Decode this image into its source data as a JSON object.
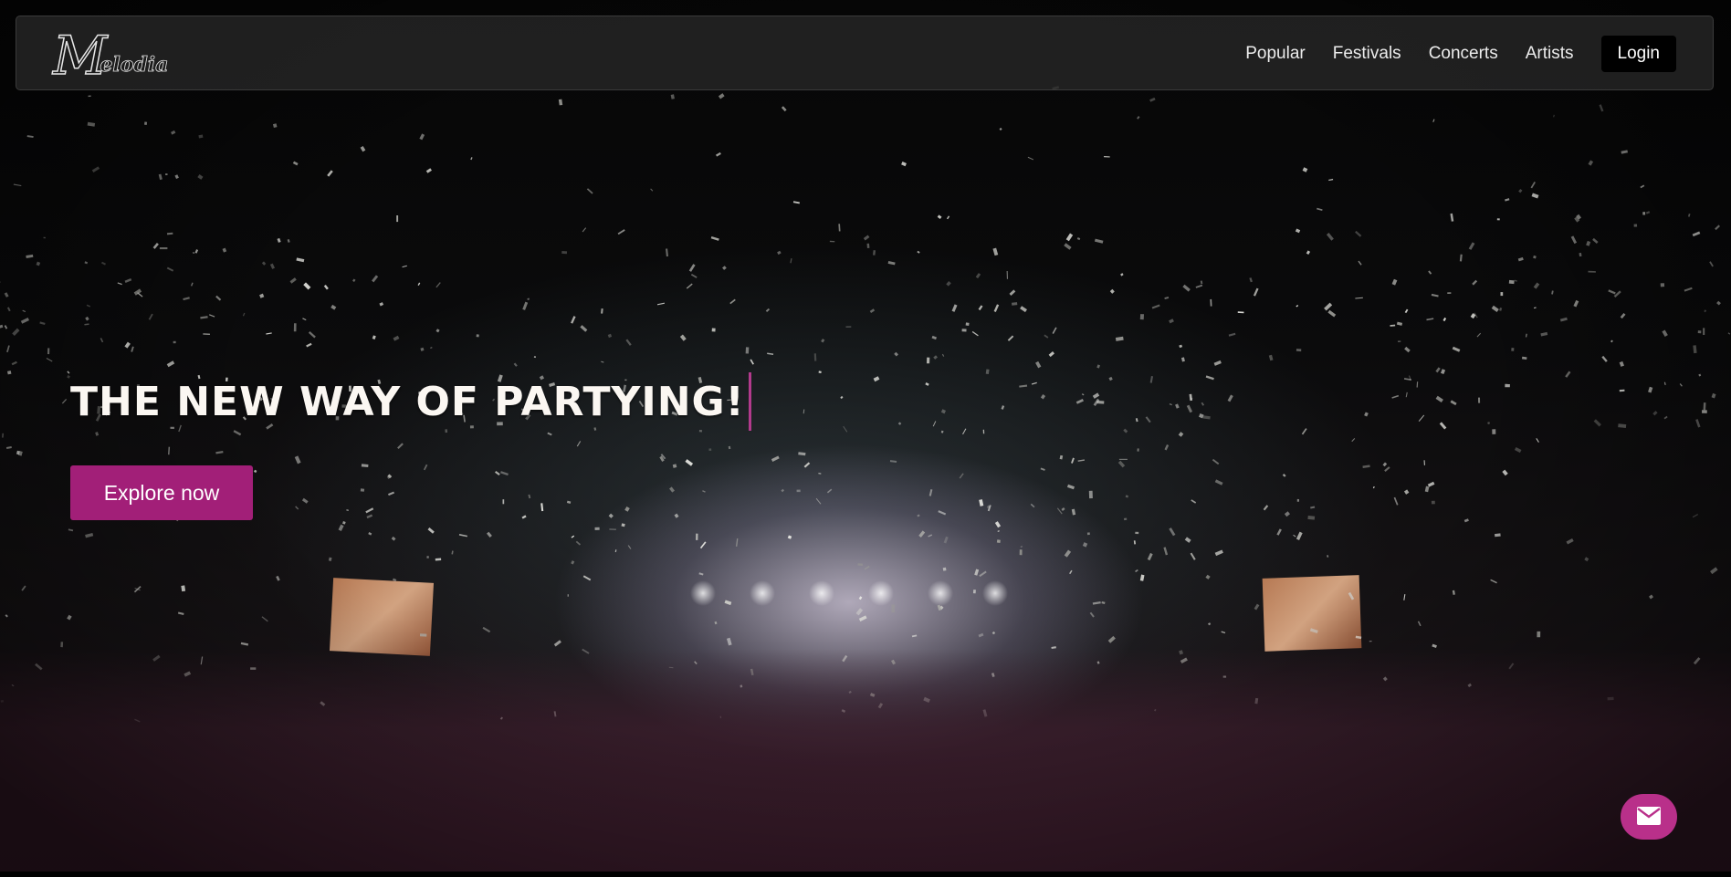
{
  "brand": {
    "logo_initial": "M",
    "logo_rest": "elodia"
  },
  "nav": {
    "links": [
      {
        "label": "Popular"
      },
      {
        "label": "Festivals"
      },
      {
        "label": "Concerts"
      },
      {
        "label": "Artists"
      }
    ],
    "login_label": "Login"
  },
  "hero": {
    "headline": "THE NEW WAY OF PARTYING!",
    "cta_label": "Explore now",
    "background": "concert-crowd-confetti-photo"
  },
  "floating": {
    "contact_icon": "mail-icon"
  },
  "colors": {
    "accent": "#a21f78",
    "contact_button": "#b9308a",
    "caret": "#b23a8c",
    "navbar": "#262626",
    "login_button": "#000000"
  }
}
